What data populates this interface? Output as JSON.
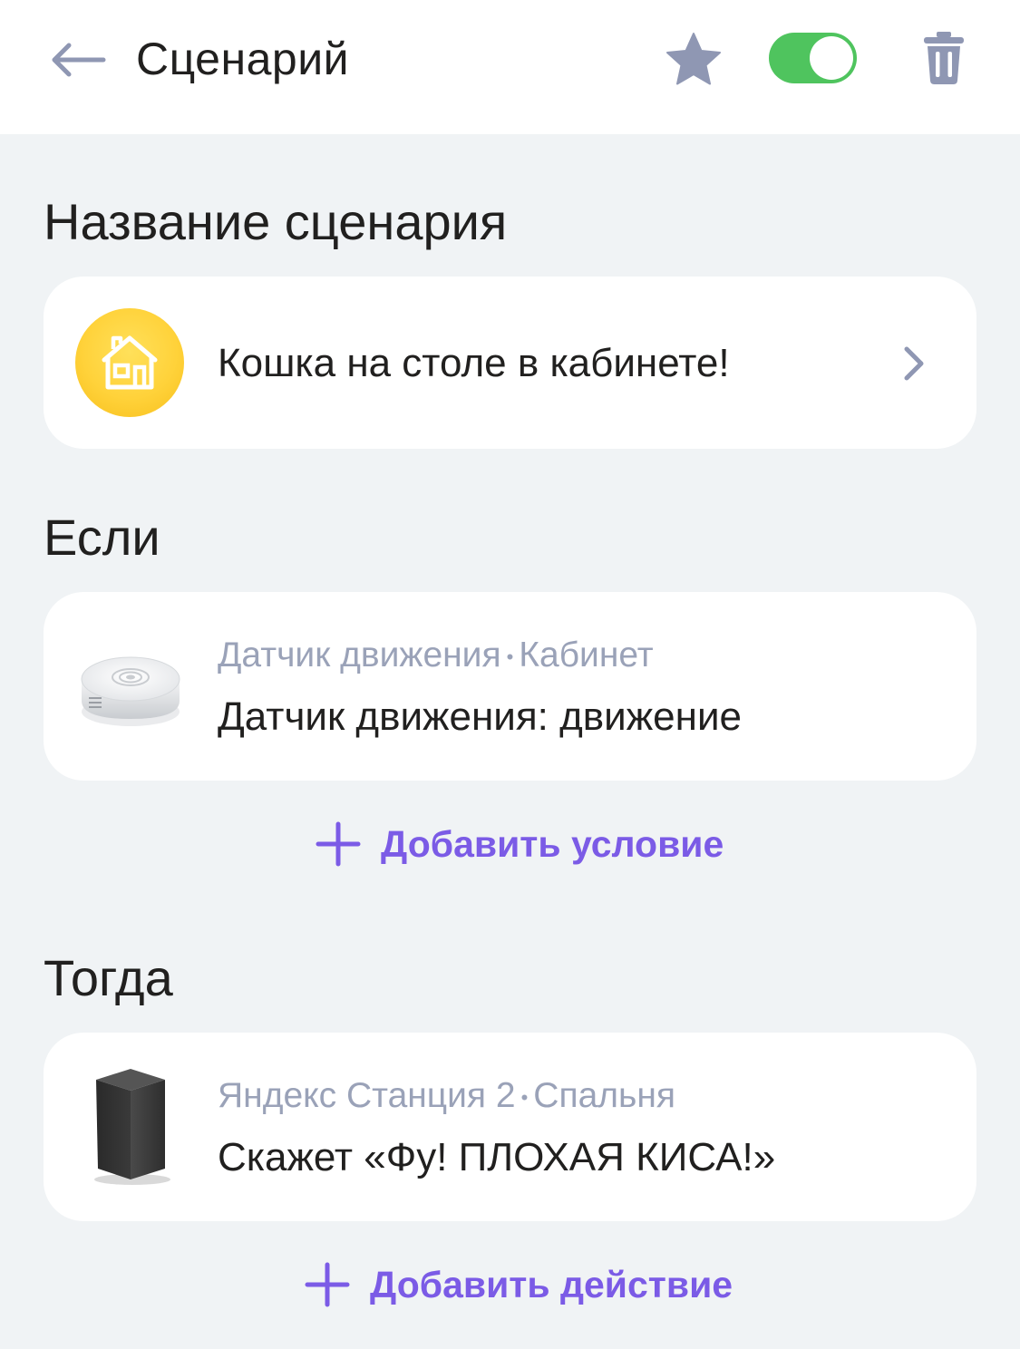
{
  "header": {
    "title": "Сценарий",
    "back_icon": "arrow-left-icon",
    "favorite_icon": "star-icon",
    "enabled": true,
    "delete_icon": "trash-icon"
  },
  "name_section": {
    "title": "Название сценария",
    "scenario_name": "Кошка на столе в кабинете!",
    "icon": "house-icon",
    "icon_color": "#ffd23a"
  },
  "if_section": {
    "title": "Если",
    "condition": {
      "device": "Датчик движения",
      "room": "Кабинет",
      "separator": "•",
      "description": "Датчик движения: движение",
      "image": "motion-sensor-image"
    },
    "add_label": "Добавить условие"
  },
  "then_section": {
    "title": "Тогда",
    "action": {
      "device": "Яндекс Станция 2",
      "room": "Спальня",
      "separator": "•",
      "description": "Скажет «Фу! ПЛОХАЯ КИСА!»",
      "image": "smart-speaker-image"
    },
    "add_label": "Добавить действие"
  },
  "colors": {
    "background": "#f0f3f5",
    "accent": "#7b5be6",
    "toggle_on": "#4fc45e",
    "icon_gray": "#8f97b3",
    "meta_text": "#9aa2b8"
  }
}
